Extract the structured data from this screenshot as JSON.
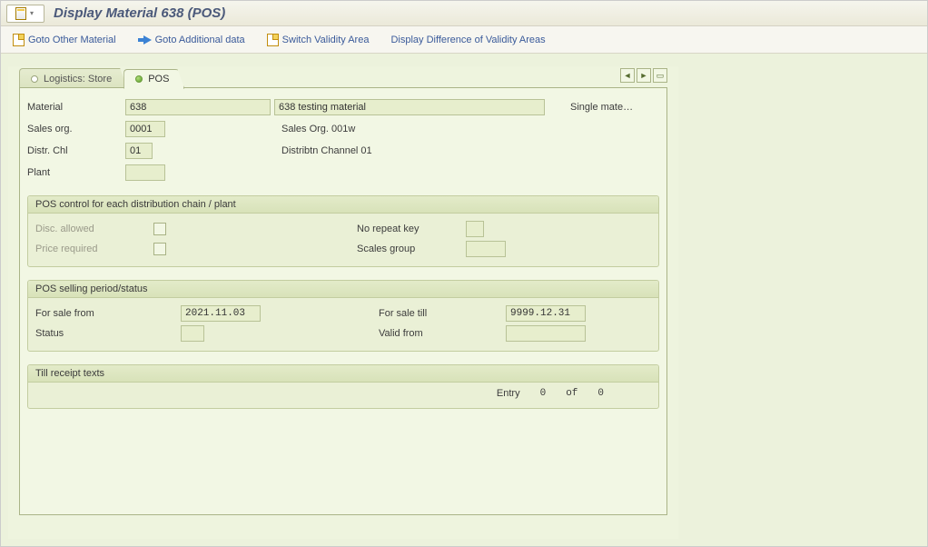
{
  "title": "Display Material 638 (POS)",
  "toolbar": {
    "goto_other": "Goto Other Material",
    "goto_additional": "Goto Additional data",
    "switch_validity": "Switch Validity Area",
    "display_diff": "Display Difference of Validity Areas"
  },
  "tabs": {
    "logistics": "Logistics: Store",
    "pos": "POS"
  },
  "header_fields": {
    "material_label": "Material",
    "material_value": "638",
    "material_desc": "638 testing material",
    "material_type": "Single mate…",
    "sales_org_label": "Sales org.",
    "sales_org_value": "0001",
    "sales_org_desc": "Sales Org. 001w",
    "distr_chl_label": "Distr. Chl",
    "distr_chl_value": "01",
    "distr_chl_desc": "Distribtn Channel 01",
    "plant_label": "Plant",
    "plant_value": ""
  },
  "group_pos_control": {
    "title": "POS control for each distribution chain / plant",
    "disc_allowed": "Disc. allowed",
    "price_required": "Price required",
    "no_repeat_key": "No repeat key",
    "scales_group": "Scales group",
    "scales_group_value": ""
  },
  "group_selling_period": {
    "title": "POS selling period/status",
    "for_sale_from": "For sale from",
    "for_sale_from_value": "2021.11.03",
    "for_sale_till": "For sale till",
    "for_sale_till_value": "9999.12.31",
    "status": "Status",
    "status_value": "",
    "valid_from": "Valid from",
    "valid_from_value": ""
  },
  "group_receipt": {
    "title": "Till receipt texts",
    "entry_label": "Entry",
    "entry_current": "0",
    "entry_of": "of",
    "entry_total": "0"
  }
}
